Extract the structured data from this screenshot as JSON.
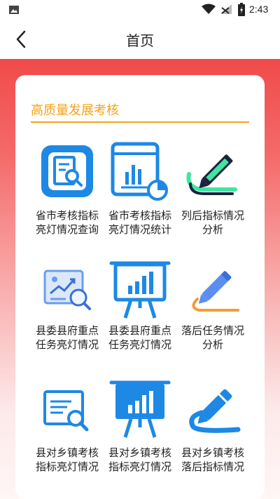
{
  "status_bar": {
    "time": "2:43"
  },
  "header": {
    "title": "首页"
  },
  "section": {
    "title": "高质量发展考核"
  },
  "items": [
    {
      "label": "省市考核指标亮灯情况查询",
      "icon": "report-search-icon"
    },
    {
      "label": "省市考核指标亮灯情况统计报表",
      "icon": "chart-report-icon"
    },
    {
      "label": "列后指标情况分析",
      "icon": "pen-analysis-icon"
    },
    {
      "label": "县委县府重点任务亮灯情况查询",
      "icon": "trend-search-icon"
    },
    {
      "label": "县委县府重点任务亮灯情况统计报表",
      "icon": "easel-chart-icon"
    },
    {
      "label": "落后任务情况分析",
      "icon": "pen-analysis-icon"
    },
    {
      "label": "县对乡镇考核指标亮灯情况查询",
      "icon": "document-search-icon"
    },
    {
      "label": "县对乡镇考核指标亮灯情况统计报表",
      "icon": "easel-chart-icon"
    },
    {
      "label": "县对乡镇考核落后指标情况分析",
      "icon": "pen-analysis-icon"
    }
  ],
  "colors": {
    "accent": "#f3a21a",
    "icon_blue": "#1e88e5",
    "header_red": "#f04a4a"
  }
}
